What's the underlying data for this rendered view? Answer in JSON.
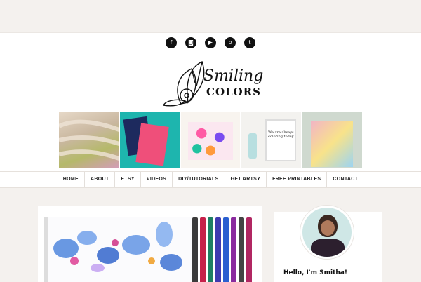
{
  "social": [
    {
      "name": "facebook-icon",
      "glyph": "f"
    },
    {
      "name": "instagram-icon",
      "glyph": "◙"
    },
    {
      "name": "youtube-icon",
      "glyph": "▶"
    },
    {
      "name": "pinterest-icon",
      "glyph": "p"
    },
    {
      "name": "twitter-icon",
      "glyph": "t"
    }
  ],
  "logo": {
    "line1": "Smiling",
    "line2": "COLORS"
  },
  "nav": [
    "HOME",
    "ABOUT",
    "ETSY",
    "VIDEOS",
    "DIY/TUTORIALS",
    "GET ARTSY",
    "FREE PRINTABLES",
    "CONTACT"
  ],
  "banner_overlay_text": "We are always coloring today",
  "sidebar": {
    "greeting": "Hello, I'm Smitha!"
  },
  "colors": {
    "accent": "#111111",
    "background": "#f4f1ee"
  }
}
